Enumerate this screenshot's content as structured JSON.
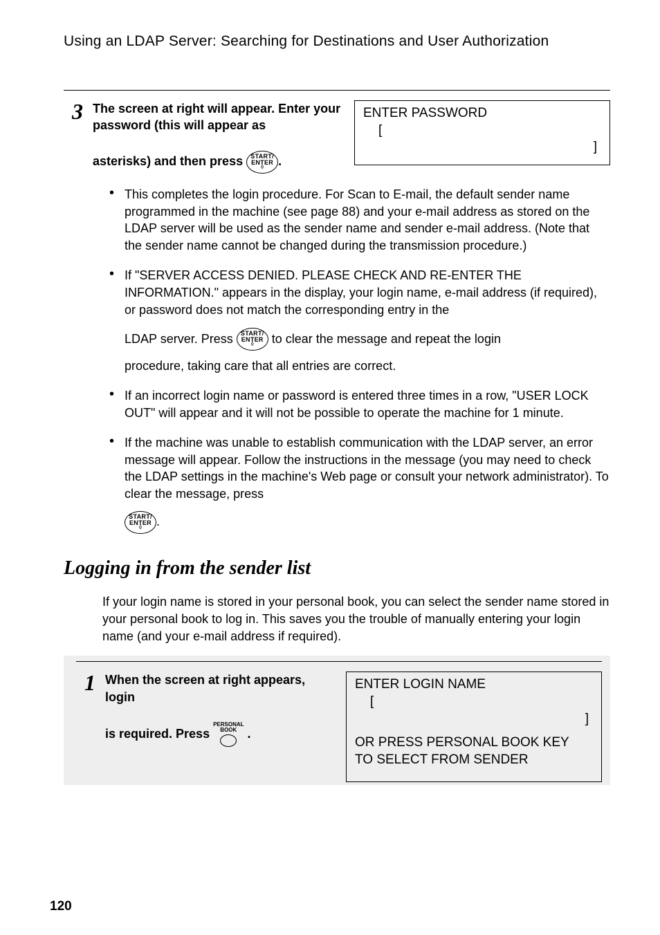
{
  "subhead": "Using an LDAP Server: Searching for Destinations and User Authorization",
  "step3": {
    "num": "3",
    "left_line1": "The screen at right will appear. Enter your password (this will appear as",
    "left_line2a": "asterisks) and then press ",
    "left_line2b": ".",
    "btn_top": "START/",
    "btn_bot": "ENTER",
    "display_l1": "ENTER PASSWORD",
    "display_l2": "[",
    "display_l3": "]"
  },
  "bullets": {
    "b1": "This completes the login procedure. For Scan to E-mail, the default sender name programmed in the machine (see page 88) and your e-mail address as stored on the LDAP server will be used as the sender name and sender e-mail address. (Note that the sender name cannot be changed during the transmission procedure.)",
    "b2a": "If \"SERVER ACCESS DENIED. PLEASE CHECK AND RE-ENTER THE INFORMATION.\" appears in the display, your login name, e-mail address (if required), or password does not match the corresponding entry in the",
    "b2b": "LDAP server. Press ",
    "b2c": " to clear the message and repeat the login",
    "b2d": "procedure, taking care that all entries are correct.",
    "b3": " If an incorrect login name or password is entered three times in a row, \"USER LOCK OUT\" will appear and it will not be possible to operate the machine for 1 minute.",
    "b4a": "If the machine was unable to establish communication with the LDAP server, an error message will appear. Follow the instructions in the message (you may need to check the LDAP settings in the machine's Web page or consult your network administrator). To clear the message, press",
    "b4b": "."
  },
  "section_head": "Logging in from the sender list",
  "intro": "If your login name is stored in your personal book, you can select the sender name stored in your personal book to log in. This saves you the trouble of manually entering your login name (and your e-mail address if required).",
  "step1": {
    "num": "1",
    "left_a": "When the screen at right appears, login",
    "left_b": "is required. Press ",
    "left_c": ".",
    "personal_top": "PERSONAL",
    "personal_bot": "BOOK",
    "display_l1": "ENTER LOGIN NAME",
    "display_l2": "[",
    "display_l3": "]",
    "display_l4": "OR PRESS PERSONAL BOOK KEY",
    "display_l5": "TO SELECT FROM SENDER"
  },
  "page_num": "120"
}
